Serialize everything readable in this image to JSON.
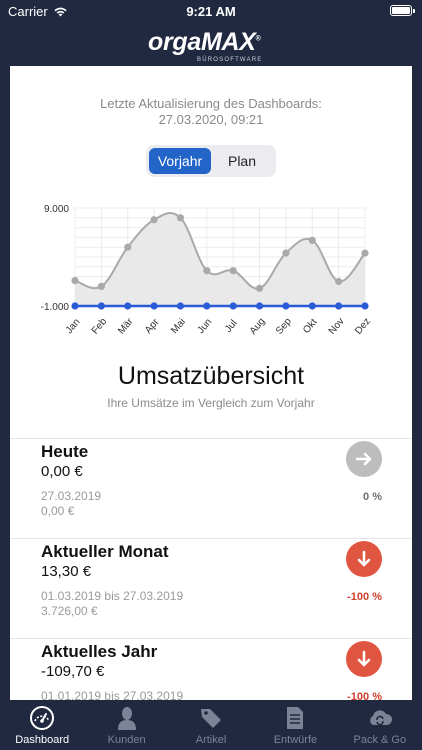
{
  "status_bar": {
    "carrier": "Carrier",
    "time": "9:21 AM"
  },
  "header": {
    "logo_part1": "orga",
    "logo_part2": "MAX",
    "logo_reg": "®",
    "logo_sub": "BÜROSOFTWARE"
  },
  "update": {
    "label": "Letzte Aktualisierung des Dashboards:",
    "value": "27.03.2020, 09:21"
  },
  "segment": {
    "options": [
      "Vorjahr",
      "Plan"
    ],
    "selected": "Vorjahr"
  },
  "chart_data": {
    "type": "line",
    "categories": [
      "Jan",
      "Feb",
      "Mär",
      "Apr",
      "Mai",
      "Jun",
      "Jul",
      "Aug",
      "Sep",
      "Okt",
      "Nov",
      "Dez"
    ],
    "series": [
      {
        "values": [
          1600,
          1000,
          5000,
          7800,
          8000,
          2600,
          2600,
          800,
          4400,
          5700,
          1500,
          4400
        ],
        "color": "#a9a9a9"
      },
      {
        "values": [
          -1000,
          -1000,
          -1000,
          -1000,
          -1000,
          -1000,
          -1000,
          -1000,
          -1000,
          -1000,
          -1000,
          -1000
        ],
        "color": "#2a5bd7"
      }
    ],
    "ylim": [
      -1000,
      9000
    ],
    "ytick_labels": [
      "9.000",
      "-1.000"
    ],
    "grid": true,
    "area_color": "#e9e9e9",
    "area_color_current": "#c9d6f5"
  },
  "main": {
    "title": "Umsatzübersicht",
    "subtitle": "Ihre Umsätze im Vergleich zum Vorjahr"
  },
  "sections": [
    {
      "title": "Heute",
      "value": "0,00 €",
      "date_line": "27.03.2019",
      "compare_value": "0,00 €",
      "percent": "0 %",
      "status": "neutral",
      "icon": "arrow-right-icon",
      "color": "#bdbdbd",
      "pct_color": "#6e6e6e"
    },
    {
      "title": "Aktueller Monat",
      "value": "13,30 €",
      "date_line": "01.03.2019 bis 27.03.2019",
      "compare_value": "3.726,00 €",
      "percent": "-100 %",
      "status": "down",
      "icon": "arrow-down-icon",
      "color": "#e0553f",
      "pct_color": "#d0402e"
    },
    {
      "title": "Aktuelles Jahr",
      "value": "-109,70 €",
      "date_line": "01.01.2019 bis 27.03.2019",
      "compare_value": "",
      "percent": "-100 %",
      "status": "down",
      "icon": "arrow-down-icon",
      "color": "#e0553f",
      "pct_color": "#d0402e"
    }
  ],
  "tabs": [
    {
      "label": "Dashboard",
      "icon": "gauge-icon",
      "active": true
    },
    {
      "label": "Kunden",
      "icon": "person-icon",
      "active": false
    },
    {
      "label": "Artikel",
      "icon": "tag-icon",
      "active": false
    },
    {
      "label": "Entwürfe",
      "icon": "document-icon",
      "active": false
    },
    {
      "label": "Pack & Go",
      "icon": "cloud-sync-icon",
      "active": false
    }
  ]
}
